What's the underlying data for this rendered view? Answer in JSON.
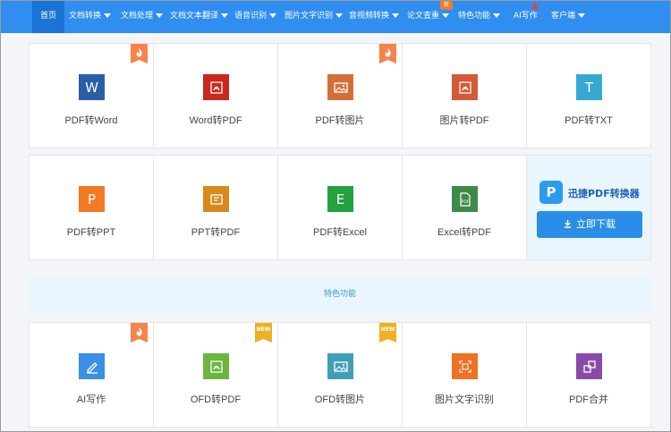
{
  "nav": {
    "items": [
      {
        "label": "首页",
        "active": true,
        "dropdown": false
      },
      {
        "label": "文档转换",
        "active": false,
        "dropdown": true
      },
      {
        "label": "文档处理",
        "active": false,
        "dropdown": true
      },
      {
        "label": "文档文本翻译",
        "active": false,
        "dropdown": true
      },
      {
        "label": "语音识别",
        "active": false,
        "dropdown": true
      },
      {
        "label": "图片文字识别",
        "active": false,
        "dropdown": true
      },
      {
        "label": "音视频转换",
        "active": false,
        "dropdown": true
      },
      {
        "label": "论文查重",
        "active": false,
        "dropdown": true
      },
      {
        "label": "特色功能",
        "active": false,
        "dropdown": true
      },
      {
        "label": "AI写作",
        "active": false,
        "dropdown": false
      },
      {
        "label": "客户端",
        "active": false,
        "dropdown": true
      }
    ],
    "new_badge": "新",
    "colors": {
      "bar": "#2f8ef0",
      "active": "#1a73d6"
    }
  },
  "row1": [
    {
      "label": "PDF转Word",
      "icon": "word-icon",
      "glyph": "W",
      "color": "#2b5ea8",
      "corner": "hot"
    },
    {
      "label": "Word转PDF",
      "icon": "pdf-icon",
      "glyph": "",
      "color": "#c8281e",
      "corner": ""
    },
    {
      "label": "PDF转图片",
      "icon": "image-icon",
      "glyph": "",
      "color": "#d3703a",
      "corner": "hot"
    },
    {
      "label": "图片转PDF",
      "icon": "pdf-icon",
      "glyph": "",
      "color": "#d25a36",
      "corner": ""
    },
    {
      "label": "PDF转TXT",
      "icon": "text-icon",
      "glyph": "T",
      "color": "#35a9cf",
      "corner": ""
    }
  ],
  "row2": [
    {
      "label": "PDF转PPT",
      "icon": "ppt-icon",
      "glyph": "P",
      "color": "#f37a24",
      "corner": ""
    },
    {
      "label": "PPT转PDF",
      "icon": "ppt-to-pdf-icon",
      "glyph": "",
      "color": "#d78a1b",
      "corner": ""
    },
    {
      "label": "PDF转Excel",
      "icon": "excel-icon",
      "glyph": "E",
      "color": "#23a23f",
      "corner": ""
    },
    {
      "label": "Excel转PDF",
      "icon": "excel-pdf-icon",
      "glyph": "",
      "color": "#3e8a4a",
      "corner": ""
    }
  ],
  "promo": {
    "title": "迅捷PDF转换器",
    "logo_glyph": "P",
    "button": "立即下载"
  },
  "section": {
    "title": "特色功能"
  },
  "row3": [
    {
      "label": "AI写作",
      "icon": "pen-icon",
      "glyph": "",
      "color": "#3a8fe6",
      "corner": "hot"
    },
    {
      "label": "OFD转PDF",
      "icon": "pdf-icon",
      "glyph": "",
      "color": "#6cb53f",
      "corner": "new"
    },
    {
      "label": "OFD转图片",
      "icon": "image-icon",
      "glyph": "",
      "color": "#3f9fb8",
      "corner": "new"
    },
    {
      "label": "图片文字识别",
      "icon": "ocr-icon",
      "glyph": "",
      "color": "#f07024",
      "corner": ""
    },
    {
      "label": "PDF合并",
      "icon": "merge-icon",
      "glyph": "",
      "color": "#8a4aa8",
      "corner": ""
    }
  ],
  "corner_labels": {
    "new": "NEW"
  },
  "accent_colors": {
    "hot": "#f7834a",
    "new": "#f0b022"
  }
}
